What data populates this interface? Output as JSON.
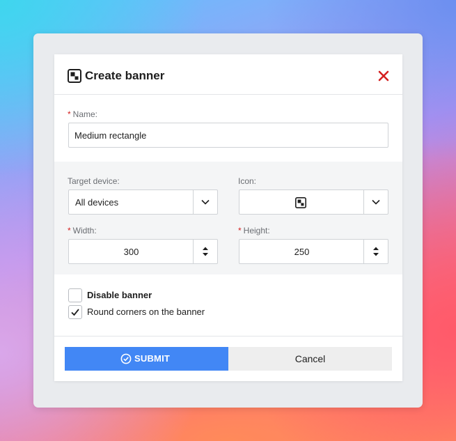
{
  "dialog": {
    "title": "Create banner",
    "title_icon": "banner-icon",
    "close_icon": "close-icon"
  },
  "name_field": {
    "required_mark": "*",
    "label": "Name:",
    "value": "Medium rectangle"
  },
  "target_device": {
    "label": "Target device:",
    "selected": "All devices"
  },
  "icon_select": {
    "label": "Icon:",
    "selected_icon": "banner-icon"
  },
  "width_field": {
    "required_mark": "*",
    "label": "Width:",
    "value": "300"
  },
  "height_field": {
    "required_mark": "*",
    "label": "Height:",
    "value": "250"
  },
  "options": {
    "disable_banner": {
      "label": "Disable banner",
      "checked": false
    },
    "round_corners": {
      "label": "Round corners on the banner",
      "checked": true
    }
  },
  "actions": {
    "submit_label": "SUBMIT",
    "cancel_label": "Cancel"
  },
  "colors": {
    "accent": "#4287f5",
    "close": "#d42020",
    "required": "#d42020"
  }
}
